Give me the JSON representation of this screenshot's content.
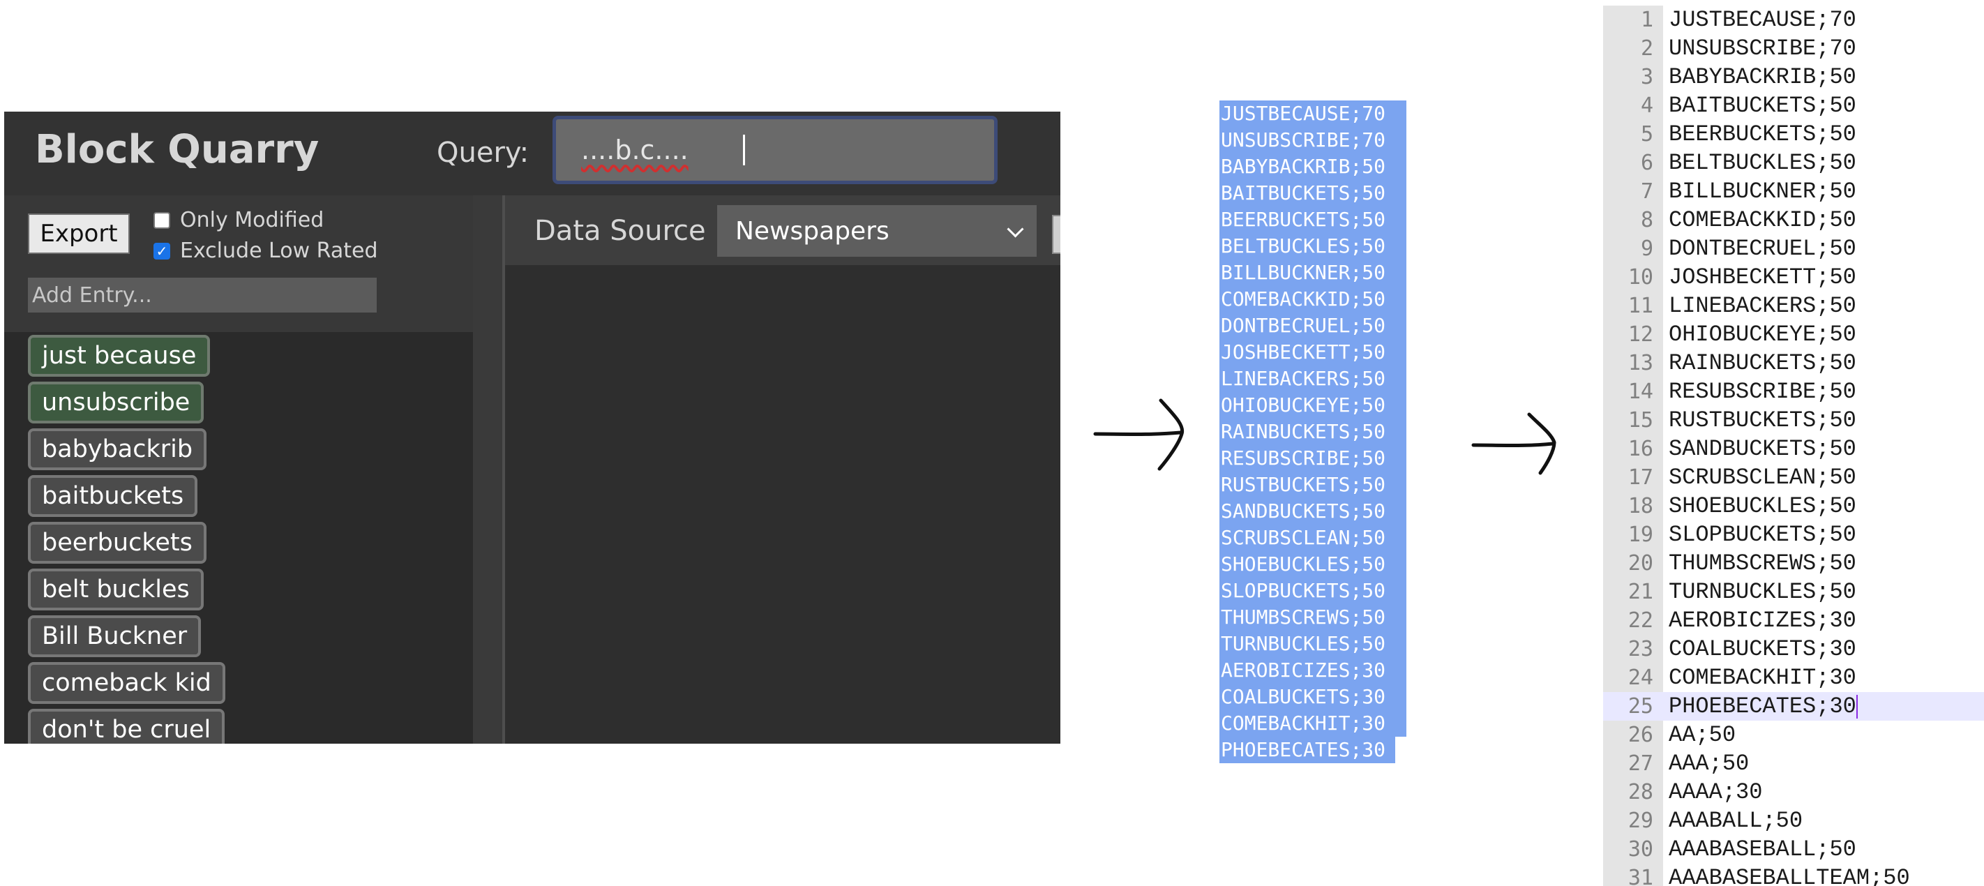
{
  "app": {
    "title": "Block Quarry",
    "query_label": "Query:",
    "query_value": "....b.c....",
    "export_label": "Export",
    "only_modified_label": "Only Modified",
    "only_modified_checked": false,
    "exclude_low_rated_label": "Exclude Low Rated",
    "exclude_low_rated_checked": true,
    "add_entry_placeholder": "Add Entry...",
    "entries": [
      {
        "label": "just because",
        "modified": true
      },
      {
        "label": "unsubscribe",
        "modified": true
      },
      {
        "label": "babybackrib",
        "modified": false
      },
      {
        "label": "baitbuckets",
        "modified": false
      },
      {
        "label": "beerbuckets",
        "modified": false
      },
      {
        "label": "belt buckles",
        "modified": false
      },
      {
        "label": "Bill Buckner",
        "modified": false
      },
      {
        "label": "comeback kid",
        "modified": false
      },
      {
        "label": "don't be cruel",
        "modified": false
      }
    ],
    "data_source_label": "Data Source",
    "data_source_value": "Newspapers"
  },
  "selection_lines": [
    "JUSTBECAUSE;70",
    "UNSUBSCRIBE;70",
    "BABYBACKRIB;50",
    "BAITBUCKETS;50",
    "BEERBUCKETS;50",
    "BELTBUCKLES;50",
    "BILLBUCKNER;50",
    "COMEBACKKID;50",
    "DONTBECRUEL;50",
    "JOSHBECKETT;50",
    "LINEBACKERS;50",
    "OHIOBUCKEYE;50",
    "RAINBUCKETS;50",
    "RESUBSCRIBE;50",
    "RUSTBUCKETS;50",
    "SANDBUCKETS;50",
    "SCRUBSCLEAN;50",
    "SHOEBUCKLES;50",
    "SLOPBUCKETS;50",
    "THUMBSCREWS;50",
    "TURNBUCKLES;50",
    "AEROBICIZES;30",
    "COALBUCKETS;30",
    "COMEBACKHIT;30",
    "PHOEBECATES;30"
  ],
  "editor": {
    "current_line": 25,
    "lines": [
      {
        "n": "1",
        "text": "JUSTBECAUSE;70"
      },
      {
        "n": "2",
        "text": "UNSUBSCRIBE;70"
      },
      {
        "n": "3",
        "text": "BABYBACKRIB;50"
      },
      {
        "n": "4",
        "text": "BAITBUCKETS;50"
      },
      {
        "n": "5",
        "text": "BEERBUCKETS;50"
      },
      {
        "n": "6",
        "text": "BELTBUCKLES;50"
      },
      {
        "n": "7",
        "text": "BILLBUCKNER;50"
      },
      {
        "n": "8",
        "text": "COMEBACKKID;50"
      },
      {
        "n": "9",
        "text": "DONTBECRUEL;50"
      },
      {
        "n": "10",
        "text": "JOSHBECKETT;50"
      },
      {
        "n": "11",
        "text": "LINEBACKERS;50"
      },
      {
        "n": "12",
        "text": "OHIOBUCKEYE;50"
      },
      {
        "n": "13",
        "text": "RAINBUCKETS;50"
      },
      {
        "n": "14",
        "text": "RESUBSCRIBE;50"
      },
      {
        "n": "15",
        "text": "RUSTBUCKETS;50"
      },
      {
        "n": "16",
        "text": "SANDBUCKETS;50"
      },
      {
        "n": "17",
        "text": "SCRUBSCLEAN;50"
      },
      {
        "n": "18",
        "text": "SHOEBUCKLES;50"
      },
      {
        "n": "19",
        "text": "SLOPBUCKETS;50"
      },
      {
        "n": "20",
        "text": "THUMBSCREWS;50"
      },
      {
        "n": "21",
        "text": "TURNBUCKLES;50"
      },
      {
        "n": "22",
        "text": "AEROBICIZES;30"
      },
      {
        "n": "23",
        "text": "COALBUCKETS;30"
      },
      {
        "n": "24",
        "text": "COMEBACKHIT;30"
      },
      {
        "n": "25",
        "text": "PHOEBECATES;30"
      },
      {
        "n": "26",
        "text": "AA;50"
      },
      {
        "n": "27",
        "text": "AAA;50"
      },
      {
        "n": "28",
        "text": "AAAA;30"
      },
      {
        "n": "29",
        "text": "AAABALL;50"
      },
      {
        "n": "30",
        "text": "AAABASEBALL;50"
      },
      {
        "n": "31",
        "text": "AAABASEBALLTEAM;50"
      }
    ]
  },
  "colors": {
    "app_bg": "#2b2b2b",
    "modified_entry_bg": "#3d5a40",
    "selection_bg": "#7ba4f0",
    "editor_gutter_bg": "#e4e4e4",
    "current_line_bg": "#e8e8ff"
  }
}
